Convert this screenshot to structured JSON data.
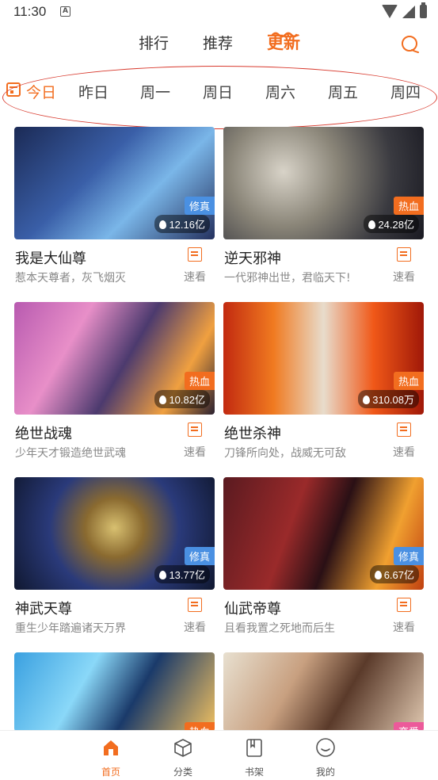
{
  "status": {
    "time": "11:30",
    "notif_letter": "A"
  },
  "nav": {
    "tabs": [
      "排行",
      "推荐",
      "更新"
    ],
    "active_index": 2
  },
  "dates": [
    "今日",
    "昨日",
    "周一",
    "周日",
    "周六",
    "周五",
    "周四"
  ],
  "cards": [
    {
      "title": "我是大仙尊",
      "subtitle": "惹本天尊者，灰飞烟灭",
      "badge": "修真",
      "badge_color": "#4a90e2",
      "views": "12.16亿",
      "action": "速看"
    },
    {
      "title": "逆天邪神",
      "subtitle": "一代邪神出世，君临天下!",
      "badge": "热血",
      "badge_color": "#f26d1f",
      "views": "24.28亿",
      "action": "速看"
    },
    {
      "title": "绝世战魂",
      "subtitle": "少年天才锻造绝世武魂",
      "badge": "热血",
      "badge_color": "#f26d1f",
      "views": "10.82亿",
      "action": "速看"
    },
    {
      "title": "绝世杀神",
      "subtitle": "刀锋所向处，战威无可敌",
      "badge": "热血",
      "badge_color": "#f26d1f",
      "views": "310.08万",
      "action": "速看"
    },
    {
      "title": "神武天尊",
      "subtitle": "重生少年踏遍诸天万界",
      "badge": "修真",
      "badge_color": "#4a90e2",
      "views": "13.77亿",
      "action": "速看"
    },
    {
      "title": "仙武帝尊",
      "subtitle": "且看我置之死地而后生",
      "badge": "修真",
      "badge_color": "#4a90e2",
      "views": "6.67亿",
      "action": "速看"
    },
    {
      "badge": "热血",
      "badge_color": "#f26d1f"
    },
    {
      "badge": "恋爱",
      "badge_color": "#ec5a9a"
    }
  ],
  "bottom": {
    "items": [
      "首页",
      "分类",
      "书架",
      "我的"
    ],
    "active_index": 0
  },
  "colors": {
    "accent": "#f26d1f",
    "annotation": "#d83a2e"
  }
}
